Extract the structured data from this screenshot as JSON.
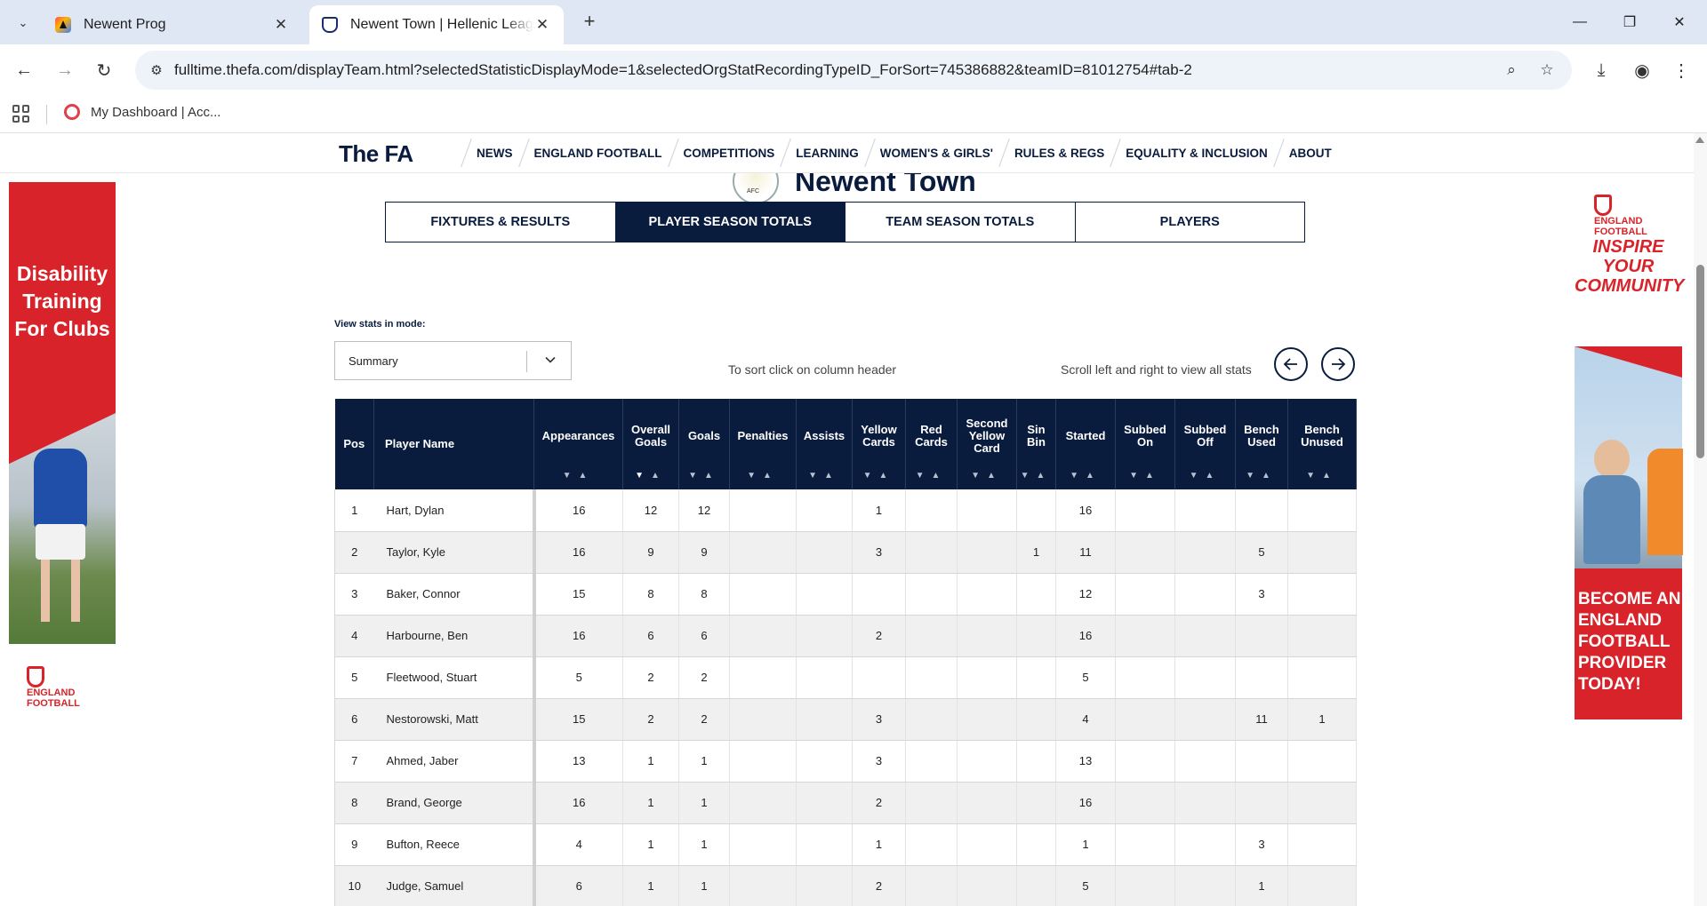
{
  "browser": {
    "tabs": [
      {
        "title": "Newent Prog",
        "active": false
      },
      {
        "title": "Newent Town | Hellenic League",
        "active": true
      }
    ],
    "url": "fulltime.thefa.com/displayTeam.html?selectedStatisticDisplayMode=1&selectedOrgStatRecordingTypeID_ForSort=745386882&teamID=81012754#tab-2",
    "bookmark": "My Dashboard | Acc..."
  },
  "site": {
    "logo": "The FA",
    "menu": [
      "NEWS",
      "ENGLAND FOOTBALL",
      "COMPETITIONS",
      "LEARNING",
      "WOMEN'S & GIRLS'",
      "RULES & REGS",
      "EQUALITY & INCLUSION",
      "ABOUT"
    ]
  },
  "team": {
    "name": "Newent Town"
  },
  "tabs": [
    {
      "label": "FIXTURES & RESULTS",
      "active": false
    },
    {
      "label": "PLAYER SEASON TOTALS",
      "active": true
    },
    {
      "label": "TEAM SEASON TOTALS",
      "active": false
    },
    {
      "label": "PLAYERS",
      "active": false
    }
  ],
  "controls": {
    "mode_label": "View stats in mode:",
    "mode_value": "Summary",
    "sort_hint": "To sort click on column header",
    "scroll_hint": "Scroll left and right to view all stats"
  },
  "table": {
    "columns": [
      "Pos",
      "Player Name",
      "Appearances",
      "Overall Goals",
      "Goals",
      "Penalties",
      "Assists",
      "Yellow Cards",
      "Red Cards",
      "Second Yellow Card",
      "Sin Bin",
      "Started",
      "Subbed On",
      "Subbed Off",
      "Bench Used",
      "Bench Unused"
    ],
    "sorted_column": "Overall Goals",
    "rows": [
      [
        "1",
        "Hart, Dylan",
        "16",
        "12",
        "12",
        "",
        "",
        "1",
        "",
        "",
        "",
        "16",
        "",
        "",
        "",
        ""
      ],
      [
        "2",
        "Taylor, Kyle",
        "16",
        "9",
        "9",
        "",
        "",
        "3",
        "",
        "",
        "1",
        "11",
        "",
        "",
        "5",
        ""
      ],
      [
        "3",
        "Baker, Connor",
        "15",
        "8",
        "8",
        "",
        "",
        "",
        "",
        "",
        "",
        "12",
        "",
        "",
        "3",
        ""
      ],
      [
        "4",
        "Harbourne, Ben",
        "16",
        "6",
        "6",
        "",
        "",
        "2",
        "",
        "",
        "",
        "16",
        "",
        "",
        "",
        ""
      ],
      [
        "5",
        "Fleetwood, Stuart",
        "5",
        "2",
        "2",
        "",
        "",
        "",
        "",
        "",
        "",
        "5",
        "",
        "",
        "",
        ""
      ],
      [
        "6",
        "Nestorowski, Matt",
        "15",
        "2",
        "2",
        "",
        "",
        "3",
        "",
        "",
        "",
        "4",
        "",
        "",
        "11",
        "1"
      ],
      [
        "7",
        "Ahmed, Jaber",
        "13",
        "1",
        "1",
        "",
        "",
        "3",
        "",
        "",
        "",
        "13",
        "",
        "",
        "",
        ""
      ],
      [
        "8",
        "Brand, George",
        "16",
        "1",
        "1",
        "",
        "",
        "2",
        "",
        "",
        "",
        "16",
        "",
        "",
        "",
        ""
      ],
      [
        "9",
        "Bufton, Reece",
        "4",
        "1",
        "1",
        "",
        "",
        "1",
        "",
        "",
        "",
        "1",
        "",
        "",
        "3",
        ""
      ],
      [
        "10",
        "Judge, Samuel",
        "6",
        "1",
        "1",
        "",
        "",
        "2",
        "",
        "",
        "",
        "5",
        "",
        "",
        "1",
        ""
      ]
    ]
  },
  "ads": {
    "left_text": "Disability Training For Clubs",
    "left_brand": "ENGLAND FOOTBALL",
    "right_brand": "ENGLAND FOOTBALL",
    "right_headline": "INSPIRE YOUR COMMUNITY",
    "right_cta": "BECOME AN ENGLAND FOOTBALL PROVIDER TODAY!",
    "brand_color": "#d9232a"
  },
  "colors": {
    "navy": "#0a1c3e",
    "chrome": "#dfe7f5"
  }
}
